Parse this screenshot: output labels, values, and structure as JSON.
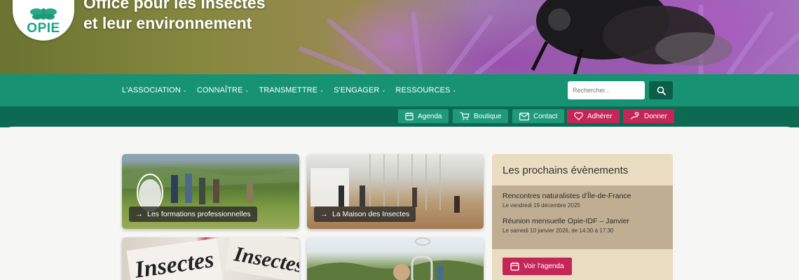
{
  "site": {
    "logo_text": "OPIE",
    "title_line1": "Office pour les insectes",
    "title_line2": "et leur environnement"
  },
  "nav": {
    "items": [
      {
        "label": "L'ASSOCIATION"
      },
      {
        "label": "CONNAÎTRE"
      },
      {
        "label": "TRANSMETTRE"
      },
      {
        "label": "S'ENGAGER"
      },
      {
        "label": "RESSOURCES"
      }
    ],
    "search_placeholder": "Rechercher..."
  },
  "utility": {
    "agenda": "Agenda",
    "boutique": "Boutique",
    "contact": "Contact",
    "adherer": "Adhérer",
    "donner": "Donner"
  },
  "cards": [
    {
      "label": "Les formations professionnelles"
    },
    {
      "label": "La Maison des Insectes"
    },
    {
      "label": ""
    },
    {
      "label": ""
    }
  ],
  "events": {
    "title": "Les prochains évènements",
    "items": [
      {
        "name": "Rencontres naturalistes d'Île-de-France",
        "date": "Le vendredi 19 décembre 2025"
      },
      {
        "name": "Réunion mensuelle Opie-IDF – Janvier",
        "date": "Le samedi 10 janvier 2026, de 14:30 à 17:30"
      }
    ],
    "button": "Voir l'agenda"
  },
  "colors": {
    "brand_green": "#179373",
    "dark_green": "#0d6a52",
    "accent_red": "#c42757",
    "events_bg": "#e9dcc0"
  }
}
